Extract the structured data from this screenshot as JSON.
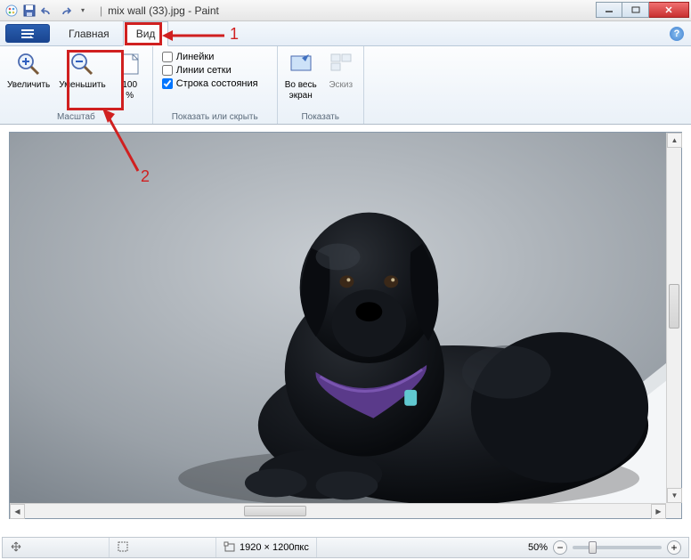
{
  "title": {
    "filename": "mix wall (33).jpg",
    "appname": "Paint"
  },
  "tabs": {
    "home": "Главная",
    "view": "Вид"
  },
  "ribbon": {
    "zoom_group": "Масштаб",
    "zoom_in": "Увеличить",
    "zoom_out": "Уменьшить",
    "zoom_100_top": "100",
    "zoom_100_bot": "%",
    "show_group": "Показать или скрыть",
    "rulers": "Линейки",
    "gridlines": "Линии сетки",
    "statusbar": "Строка состояния",
    "display_group": "Показать",
    "fullscreen_top": "Во весь",
    "fullscreen_bot": "экран",
    "thumbnail": "Эскиз"
  },
  "status": {
    "dimensions": "1920 × 1200пкс",
    "zoom": "50%"
  },
  "annotations": {
    "one": "1",
    "two": "2"
  }
}
